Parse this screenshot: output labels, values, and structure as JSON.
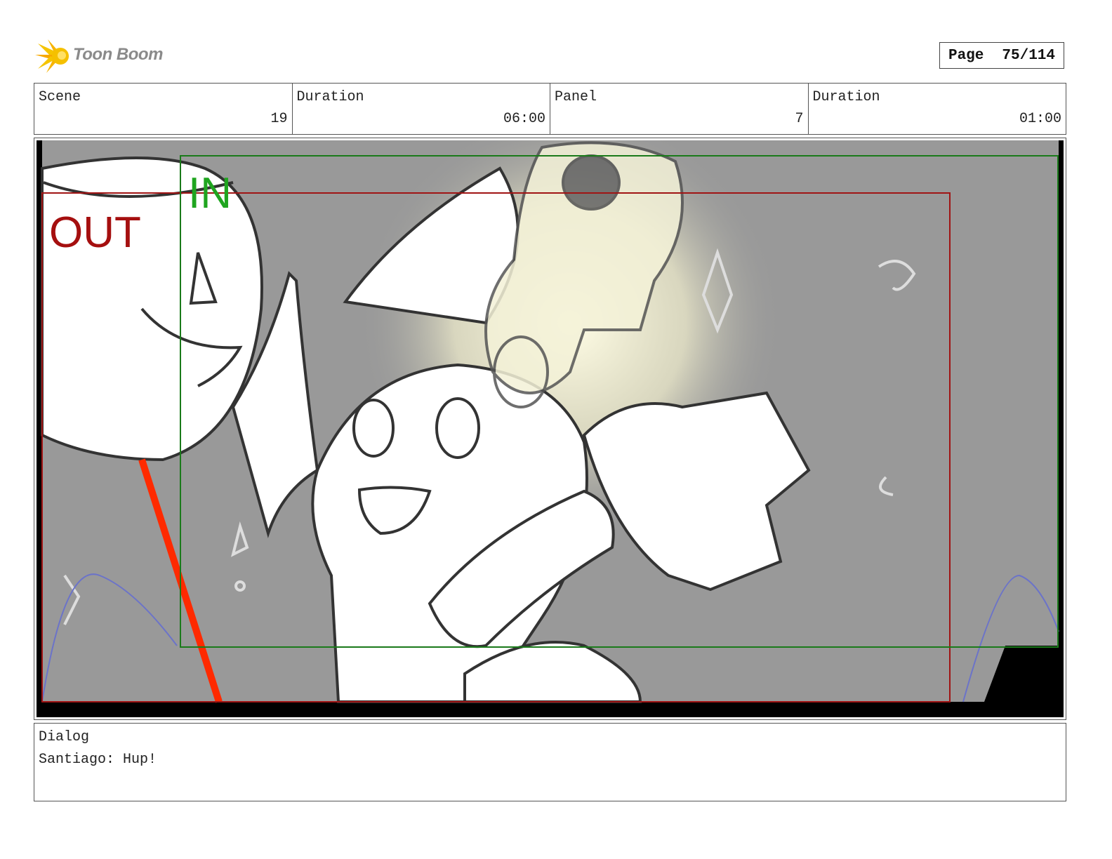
{
  "header": {
    "logo_text": "Toon Boom",
    "page_label": "Page",
    "page_value": "75/114"
  },
  "info": {
    "scene_label": "Scene",
    "scene_value": "19",
    "scene_duration_label": "Duration",
    "scene_duration_value": "06:00",
    "panel_label": "Panel",
    "panel_value": "7",
    "panel_duration_label": "Duration",
    "panel_duration_value": "01:00"
  },
  "panel": {
    "in_label": "IN",
    "out_label": "OUT",
    "in_color": "#1fa51f",
    "out_color": "#a50f0f"
  },
  "dialog": {
    "label": "Dialog",
    "text": "Santiago: Hup!"
  }
}
